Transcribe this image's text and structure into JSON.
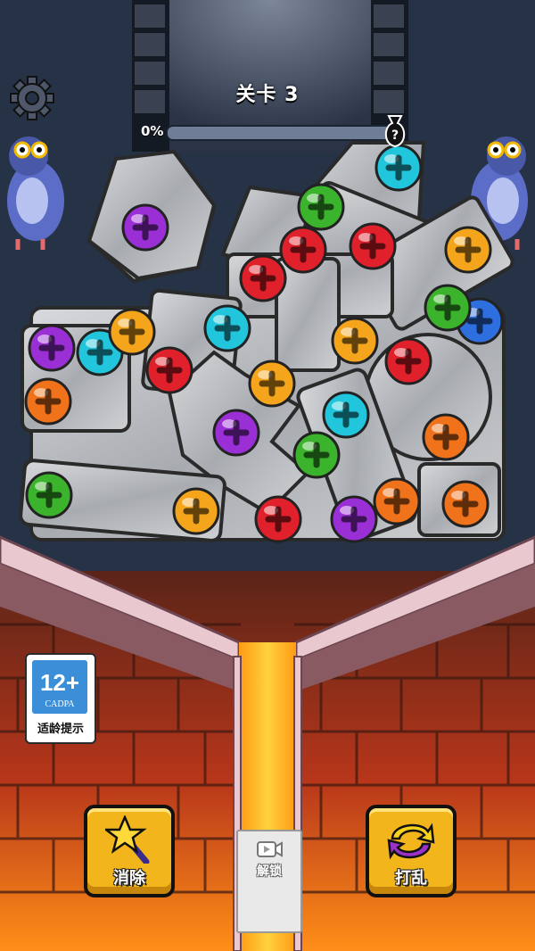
{
  "level": {
    "title": "关卡 3"
  },
  "progress": {
    "label": "0%",
    "fraction": 0.0
  },
  "hud": {
    "settings_icon": "gear-icon",
    "mystery_icon": "question-bag-icon"
  },
  "age_rating": {
    "number": "12+",
    "org": "CADPA",
    "caption": "适龄提示"
  },
  "buttons": {
    "eliminate": {
      "label": "消除",
      "icon": "magic-wand-icon"
    },
    "unlock": {
      "label": "解锁",
      "icon": "video-ad-icon"
    },
    "shuffle": {
      "label": "打乱",
      "icon": "shuffle-arrows-icon"
    }
  },
  "colors": {
    "purple": "#9b2fd6",
    "cyan": "#22c6dc",
    "red": "#e0202a",
    "orange": "#f0721a",
    "yellow": "#f4a51c",
    "green": "#3bb32c",
    "blue": "#2e6fe0",
    "lava": "#ff8a1a",
    "metal": "#b9bcc0"
  }
}
